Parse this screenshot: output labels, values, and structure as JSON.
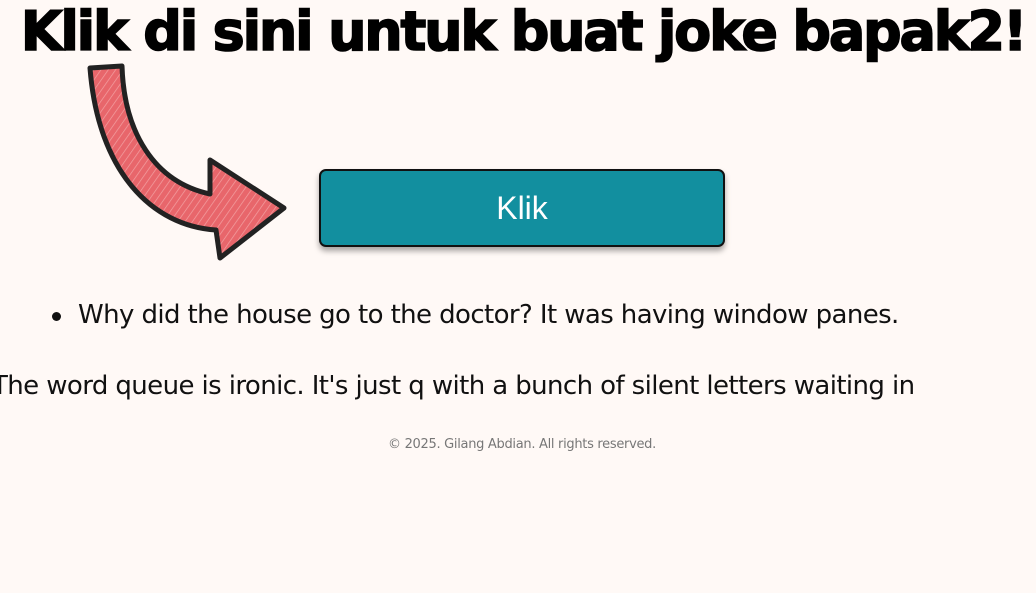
{
  "header": {
    "headline": "Klik di sini untuk buat joke bapak2!"
  },
  "pointer": {
    "icon": "curved-arrow-icon",
    "fill_color": "#e8666b",
    "outline_color": "#222222"
  },
  "action": {
    "button_label": "Klik",
    "button_color": "#128f9f"
  },
  "jokes": {
    "items": [
      "Why did the house go to the doctor? It was having window panes."
    ]
  },
  "ticker": {
    "text": "The word queue is ironic. It's just q with a bunch of silent letters waiting in"
  },
  "footer": {
    "copyright": "© 2025. Gilang Abdian. All rights reserved."
  }
}
